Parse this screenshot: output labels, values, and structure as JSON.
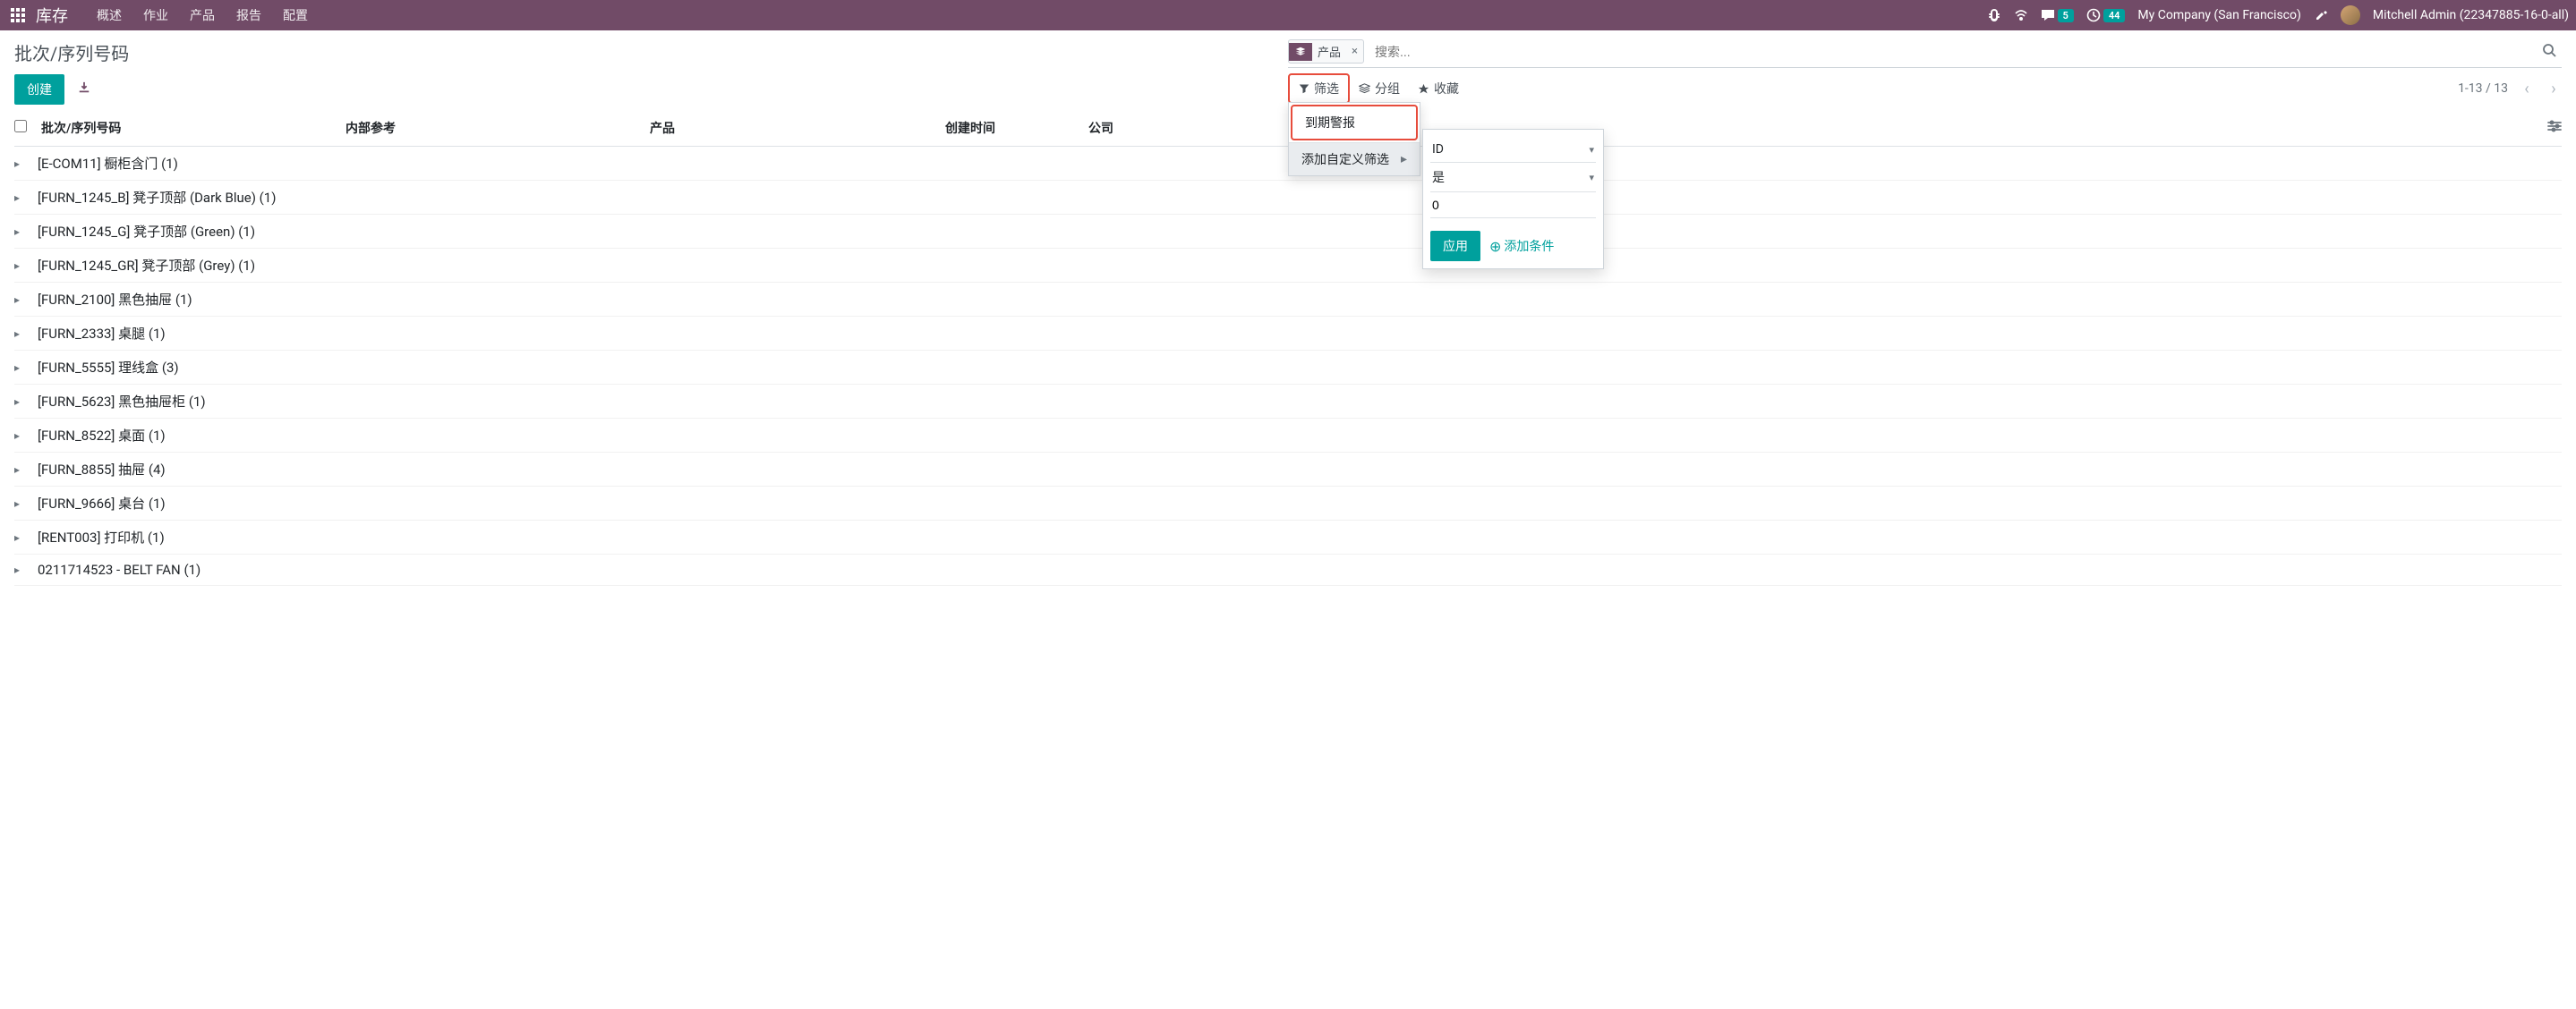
{
  "navbar": {
    "brand": "库存",
    "menu": [
      "概述",
      "作业",
      "产品",
      "报告",
      "配置"
    ],
    "messages_count": "5",
    "activities_count": "44",
    "company": "My Company (San Francisco)",
    "user": "Mitchell Admin (22347885-16-0-all)"
  },
  "breadcrumb": "批次/序列号码",
  "buttons": {
    "create": "创建"
  },
  "search": {
    "facet_label": "产品",
    "placeholder": "搜索...",
    "options": {
      "filter": "筛选",
      "groupby": "分组",
      "favorites": "收藏"
    }
  },
  "filter_dropdown": {
    "item1": "到期警报",
    "item2": "添加自定义筛选"
  },
  "custom_filter": {
    "field": "ID",
    "operator": "是",
    "value": "0",
    "apply": "应用",
    "add_condition": "添加条件"
  },
  "pager": {
    "range": "1-13 / 13"
  },
  "columns": {
    "lot": "批次/序列号码",
    "internal_ref": "内部参考",
    "product": "产品",
    "created_on": "创建时间",
    "company": "公司"
  },
  "rows": [
    "[E-COM11] 橱柜含门 (1)",
    "[FURN_1245_B] 凳子顶部 (Dark Blue) (1)",
    "[FURN_1245_G] 凳子顶部 (Green) (1)",
    "[FURN_1245_GR] 凳子顶部 (Grey) (1)",
    "[FURN_2100] 黑色抽屉 (1)",
    "[FURN_2333] 桌腿 (1)",
    "[FURN_5555] 理线盒 (3)",
    "[FURN_5623] 黑色抽屉柜 (1)",
    "[FURN_8522] 桌面 (1)",
    "[FURN_8855] 抽屉 (4)",
    "[FURN_9666] 桌台 (1)",
    "[RENT003] 打印机 (1)",
    "0211714523 - BELT FAN (1)"
  ]
}
